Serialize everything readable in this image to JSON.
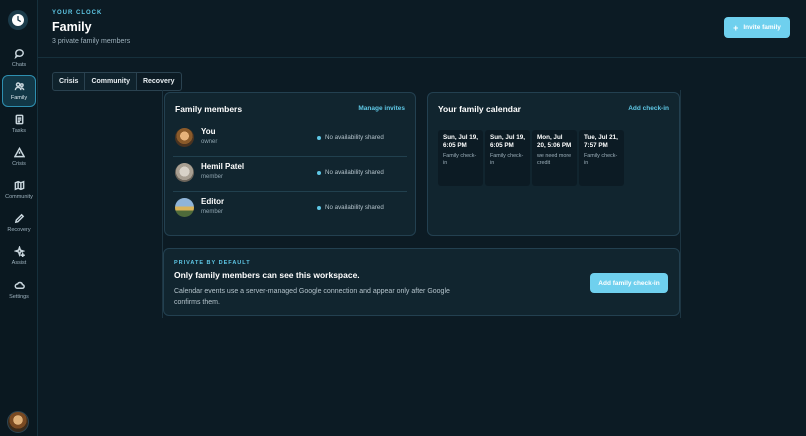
{
  "header": {
    "eyebrow": "YOUR CLOCK",
    "title": "Family",
    "subtitle": "3 private family members",
    "invite_label": "Invite family"
  },
  "sidebar": {
    "items": [
      {
        "label": "Chats",
        "icon": "chat-icon"
      },
      {
        "label": "Family",
        "icon": "family-icon",
        "active": true
      },
      {
        "label": "Tasks",
        "icon": "tasks-icon"
      },
      {
        "label": "Crisis",
        "icon": "warning-icon"
      },
      {
        "label": "Community",
        "icon": "map-icon"
      },
      {
        "label": "Recovery",
        "icon": "pencil-icon"
      },
      {
        "label": "Assist",
        "icon": "sparkle-icon"
      },
      {
        "label": "Settings",
        "icon": "cloud-icon"
      }
    ]
  },
  "tabs": [
    {
      "label": "Crisis"
    },
    {
      "label": "Community"
    },
    {
      "label": "Recovery",
      "active": true
    }
  ],
  "members_card": {
    "title": "Family members",
    "link": "Manage invites",
    "members": [
      {
        "name": "You",
        "role": "owner",
        "status": "No availability shared"
      },
      {
        "name": "Hemil Patel",
        "role": "member",
        "status": "No availability shared"
      },
      {
        "name": "Editor",
        "role": "member",
        "status": "No availability shared"
      }
    ]
  },
  "calendar_card": {
    "title": "Your family calendar",
    "link": "Add check-in",
    "events": [
      {
        "date": "Sun, Jul 19, 6:05 PM",
        "note": "Family check-in"
      },
      {
        "date": "Sun, Jul 19, 6:05 PM",
        "note": "Family check-in"
      },
      {
        "date": "Mon, Jul 20, 5:06 PM",
        "note": "we need more credit"
      },
      {
        "date": "Tue, Jul 21, 7:57 PM",
        "note": "Family check-in"
      }
    ]
  },
  "private_card": {
    "eyebrow": "PRIVATE BY DEFAULT",
    "title": "Only family members can see this workspace.",
    "body": "Calendar events use a server-managed Google connection and appear only after Google confirms them.",
    "button": "Add family check-in"
  },
  "colors": {
    "accent": "#5fc8e6",
    "button": "#6fd0ee",
    "background": "#0c1b24",
    "card": "#11252f"
  }
}
